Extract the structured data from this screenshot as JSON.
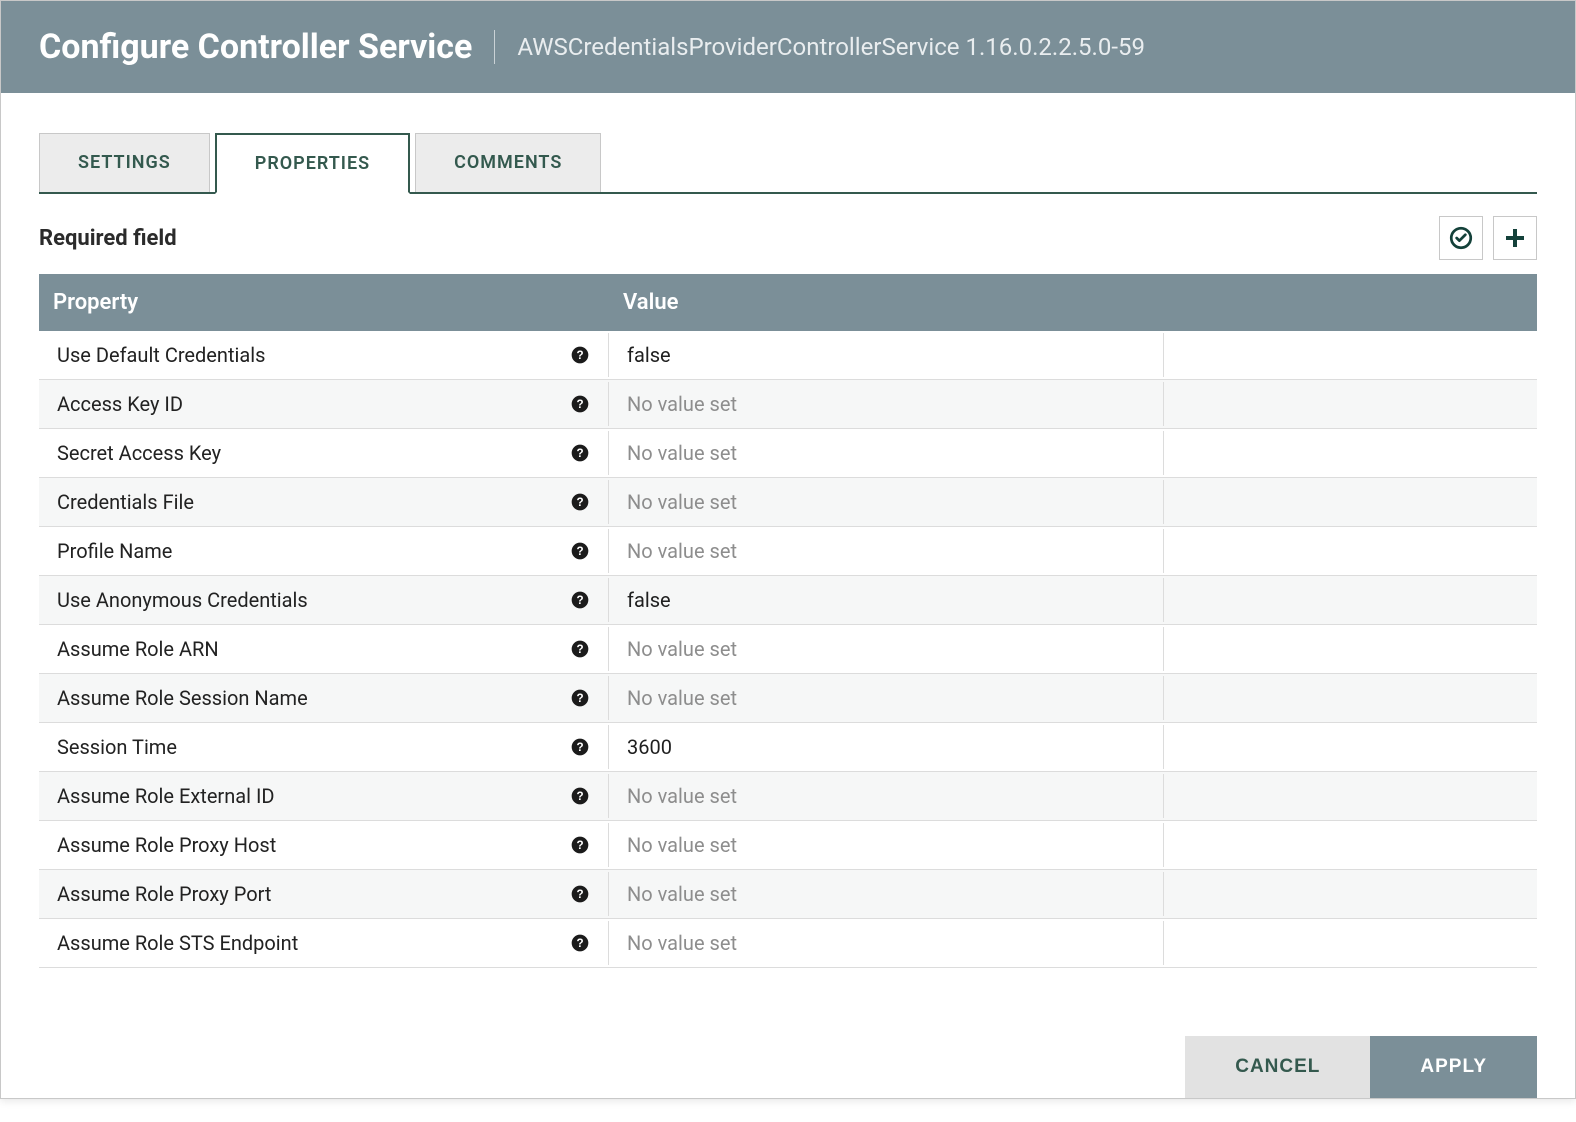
{
  "header": {
    "title": "Configure Controller Service",
    "subtitle": "AWSCredentialsProviderControllerService 1.16.0.2.2.5.0-59"
  },
  "tabs": [
    {
      "label": "SETTINGS",
      "active": false
    },
    {
      "label": "PROPERTIES",
      "active": true
    },
    {
      "label": "COMMENTS",
      "active": false
    }
  ],
  "sectionTitle": "Required field",
  "tableHeaders": {
    "property": "Property",
    "value": "Value"
  },
  "emptyValueText": "No value set",
  "properties": [
    {
      "name": "Use Default Credentials",
      "value": "false"
    },
    {
      "name": "Access Key ID",
      "value": null
    },
    {
      "name": "Secret Access Key",
      "value": null
    },
    {
      "name": "Credentials File",
      "value": null
    },
    {
      "name": "Profile Name",
      "value": null
    },
    {
      "name": "Use Anonymous Credentials",
      "value": "false"
    },
    {
      "name": "Assume Role ARN",
      "value": null
    },
    {
      "name": "Assume Role Session Name",
      "value": null
    },
    {
      "name": "Session Time",
      "value": "3600"
    },
    {
      "name": "Assume Role External ID",
      "value": null
    },
    {
      "name": "Assume Role Proxy Host",
      "value": null
    },
    {
      "name": "Assume Role Proxy Port",
      "value": null
    },
    {
      "name": "Assume Role STS Endpoint",
      "value": null
    }
  ],
  "buttons": {
    "cancel": "CANCEL",
    "apply": "APPLY"
  }
}
